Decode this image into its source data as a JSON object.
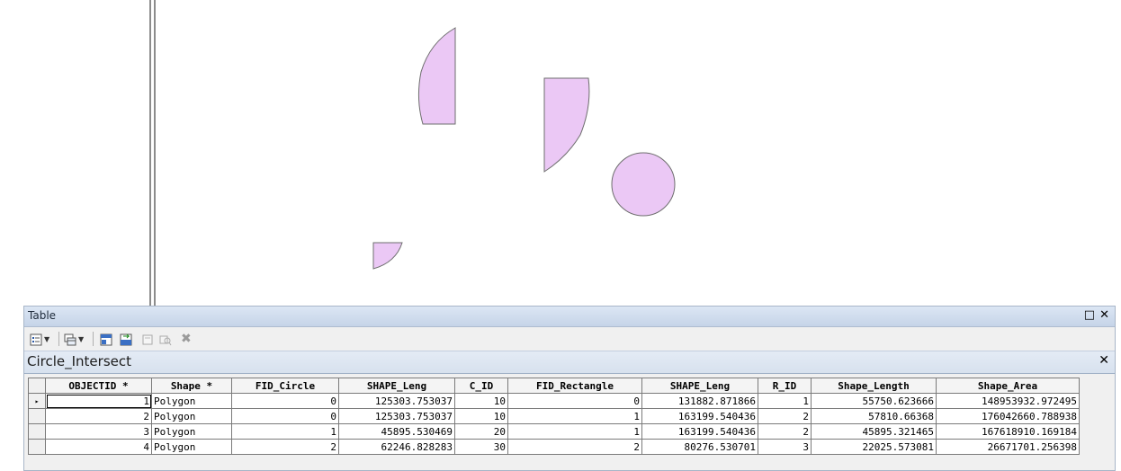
{
  "window_title": "Table",
  "title_buttons": {
    "restore": "□",
    "close": "✕"
  },
  "toolbar": {
    "options_icon": "table-options-icon",
    "related_icon": "related-tables-icon",
    "select_by_attr_icon": "select-by-attributes-icon",
    "switch_selection_icon": "switch-selection-icon",
    "clear_selection_icon": "clear-selection-icon",
    "zoom_selected_icon": "zoom-to-selected-icon",
    "delete_icon": "delete-selected-icon",
    "delete_glyph": "✖"
  },
  "layer": {
    "name": "Circle_Intersect",
    "close": "✕"
  },
  "columns": [
    "OBJECTID *",
    "Shape *",
    "FID_Circle",
    "SHAPE_Leng",
    "C_ID",
    "FID_Rectangle",
    "SHAPE_Leng",
    "R_ID",
    "Shape_Length",
    "Shape_Area"
  ],
  "rows": [
    [
      "1",
      "Polygon",
      "0",
      "125303.753037",
      "10",
      "0",
      "131882.871866",
      "1",
      "55750.623666",
      "148953932.972495"
    ],
    [
      "2",
      "Polygon",
      "0",
      "125303.753037",
      "10",
      "1",
      "163199.540436",
      "2",
      "57810.66368",
      "176042660.788938"
    ],
    [
      "3",
      "Polygon",
      "1",
      "45895.530469",
      "20",
      "1",
      "163199.540436",
      "2",
      "45895.321465",
      "167618910.169184"
    ],
    [
      "4",
      "Polygon",
      "2",
      "62246.828283",
      "30",
      "2",
      "80276.530701",
      "3",
      "22025.573081",
      "26671701.256398"
    ]
  ],
  "current_row_marker": "▸",
  "colors": {
    "feature_fill": "#ebc8f5",
    "feature_stroke": "#6e6e6e",
    "titlebar": "#c6d4e8"
  }
}
